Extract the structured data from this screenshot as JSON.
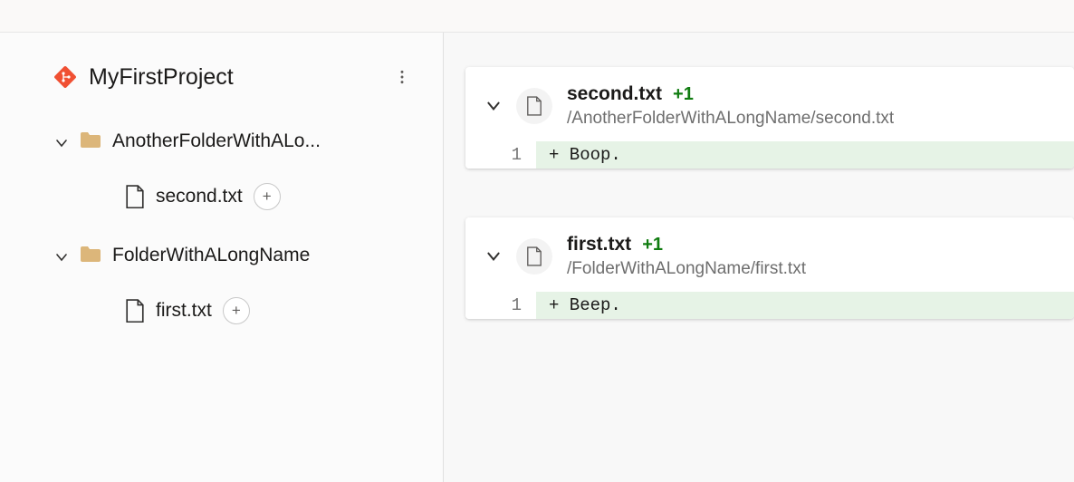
{
  "project": {
    "title": "MyFirstProject"
  },
  "tree": {
    "folders": [
      {
        "label": "AnotherFolderWithALo...",
        "file": {
          "label": "second.txt",
          "plus": "+"
        }
      },
      {
        "label": "FolderWithALongName",
        "file": {
          "label": "first.txt",
          "plus": "+"
        }
      }
    ]
  },
  "diffs": [
    {
      "fileName": "second.txt",
      "delta": "+1",
      "path": "/AnotherFolderWithALongName/second.txt",
      "lineNo": "1",
      "code": "+ Boop."
    },
    {
      "fileName": "first.txt",
      "delta": "+1",
      "path": "/FolderWithALongName/first.txt",
      "lineNo": "1",
      "code": "+ Beep."
    }
  ]
}
